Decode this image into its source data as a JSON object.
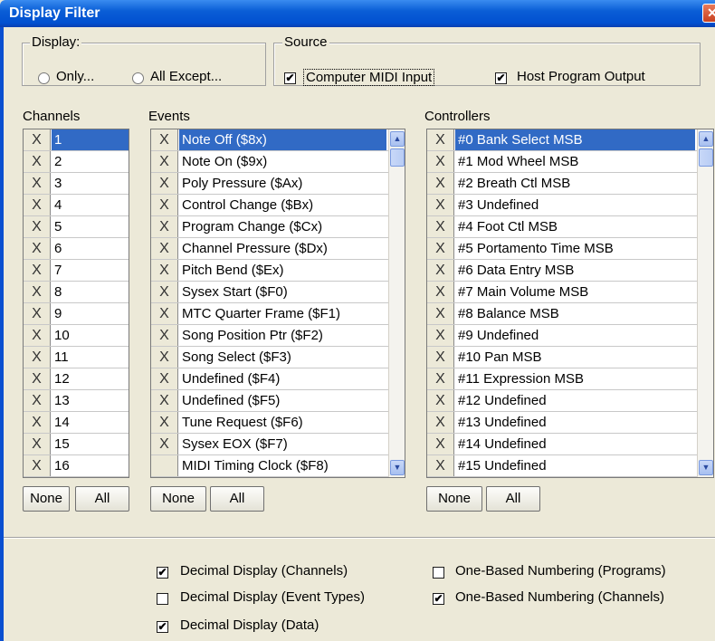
{
  "window": {
    "title": "Display Filter",
    "close_glyph": "✕"
  },
  "display_group": {
    "label": "Display:",
    "options": [
      "Only...",
      "All Except..."
    ]
  },
  "source_group": {
    "label": "Source",
    "computer_midi_input": {
      "label": "Computer MIDI Input",
      "checked": true
    },
    "host_program_output": {
      "label": "Host Program Output",
      "checked": true
    }
  },
  "channels": {
    "header": "Channels",
    "items": [
      "1",
      "2",
      "3",
      "4",
      "5",
      "6",
      "7",
      "8",
      "9",
      "10",
      "11",
      "12",
      "13",
      "14",
      "15",
      "16"
    ],
    "toggle_glyph": "X",
    "none_label": "None",
    "all_label": "All"
  },
  "events": {
    "header": "Events",
    "items": [
      {
        "label": "Note Off ($8x)",
        "x": true
      },
      {
        "label": "Note On ($9x)",
        "x": true
      },
      {
        "label": "Poly Pressure ($Ax)",
        "x": true
      },
      {
        "label": "Control Change ($Bx)",
        "x": true
      },
      {
        "label": "Program Change ($Cx)",
        "x": true
      },
      {
        "label": "Channel Pressure ($Dx)",
        "x": true
      },
      {
        "label": "Pitch Bend ($Ex)",
        "x": true
      },
      {
        "label": "Sysex Start ($F0)",
        "x": true
      },
      {
        "label": "MTC Quarter Frame ($F1)",
        "x": true
      },
      {
        "label": "Song Position Ptr ($F2)",
        "x": true
      },
      {
        "label": "Song Select ($F3)",
        "x": true
      },
      {
        "label": "Undefined ($F4)",
        "x": true
      },
      {
        "label": "Undefined ($F5)",
        "x": true
      },
      {
        "label": "Tune Request ($F6)",
        "x": true
      },
      {
        "label": "Sysex EOX ($F7)",
        "x": true
      },
      {
        "label": "MIDI Timing Clock ($F8)",
        "x": false
      }
    ],
    "none_label": "None",
    "all_label": "All"
  },
  "controllers": {
    "header": "Controllers",
    "items": [
      "#0 Bank Select MSB",
      "#1 Mod Wheel MSB",
      "#2 Breath Ctl MSB",
      "#3 Undefined",
      "#4 Foot Ctl MSB",
      "#5 Portamento Time MSB",
      "#6 Data Entry MSB",
      "#7 Main Volume MSB",
      "#8 Balance MSB",
      "#9 Undefined",
      "#10 Pan MSB",
      "#11 Expression MSB",
      "#12 Undefined",
      "#13 Undefined",
      "#14 Undefined",
      "#15 Undefined"
    ],
    "none_label": "None",
    "all_label": "All"
  },
  "options": {
    "decimal_channels": {
      "label": "Decimal Display (Channels)",
      "checked": true
    },
    "decimal_event_types": {
      "label": "Decimal Display (Event Types)",
      "checked": false
    },
    "decimal_data": {
      "label": "Decimal Display (Data)",
      "checked": true
    },
    "one_based_programs": {
      "label": "One-Based Numbering (Programs)",
      "checked": false
    },
    "one_based_channels": {
      "label": "One-Based Numbering (Channels)",
      "checked": true
    }
  },
  "icons": {
    "check": "✔",
    "scroll_up": "▲",
    "scroll_down": "▼"
  },
  "colors": {
    "selection": "#316ac5",
    "titlebar": "#0a5ed6",
    "face": "#ece9d8"
  }
}
